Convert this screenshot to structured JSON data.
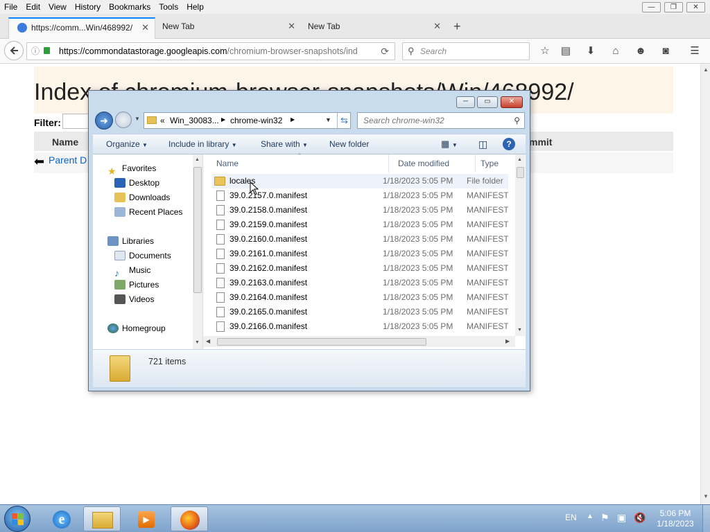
{
  "browser": {
    "menu": [
      "File",
      "Edit",
      "View",
      "History",
      "Bookmarks",
      "Tools",
      "Help"
    ],
    "window_controls": {
      "minimize": "—",
      "restore": "❐",
      "close": "✕"
    },
    "tabs": [
      {
        "label": "https://comm...Win/468992/",
        "close": "✕"
      },
      {
        "label": "New Tab",
        "close": "✕"
      },
      {
        "label": "New Tab",
        "close": "✕"
      }
    ],
    "new_tab": "+",
    "url": {
      "host": "https://commondatastorage.googleapis.com",
      "path": "/chromium-browser-snapshots/ind"
    },
    "search_placeholder": "Search",
    "reload": "⟳"
  },
  "page": {
    "heading": "Index of chromium-browser-snapshots/Win/468992/",
    "filter_label": "Filter:",
    "col_name": "Name",
    "col_commit": "mmit",
    "parent_link": "Parent D"
  },
  "dialog": {
    "breadcrumb": [
      "«",
      "Win_30083...",
      "chrome-win32"
    ],
    "search_placeholder": "Search chrome-win32",
    "toolbar": {
      "organize": "Organize",
      "include": "Include in library",
      "share": "Share with",
      "new_folder": "New folder"
    },
    "nav": {
      "favorites": "Favorites",
      "favorites_items": [
        "Desktop",
        "Downloads",
        "Recent Places"
      ],
      "libraries": "Libraries",
      "libraries_items": [
        "Documents",
        "Music",
        "Pictures",
        "Videos"
      ],
      "homegroup": "Homegroup"
    },
    "columns": {
      "name": "Name",
      "date": "Date modified",
      "type": "Type"
    },
    "files": [
      {
        "name": "locales",
        "date": "1/18/2023 5:05 PM",
        "type": "File folder",
        "folder": true
      },
      {
        "name": "39.0.2157.0.manifest",
        "date": "1/18/2023 5:05 PM",
        "type": "MANIFEST"
      },
      {
        "name": "39.0.2158.0.manifest",
        "date": "1/18/2023 5:05 PM",
        "type": "MANIFEST"
      },
      {
        "name": "39.0.2159.0.manifest",
        "date": "1/18/2023 5:05 PM",
        "type": "MANIFEST"
      },
      {
        "name": "39.0.2160.0.manifest",
        "date": "1/18/2023 5:05 PM",
        "type": "MANIFEST"
      },
      {
        "name": "39.0.2161.0.manifest",
        "date": "1/18/2023 5:05 PM",
        "type": "MANIFEST"
      },
      {
        "name": "39.0.2162.0.manifest",
        "date": "1/18/2023 5:05 PM",
        "type": "MANIFEST"
      },
      {
        "name": "39.0.2163.0.manifest",
        "date": "1/18/2023 5:05 PM",
        "type": "MANIFEST"
      },
      {
        "name": "39.0.2164.0.manifest",
        "date": "1/18/2023 5:05 PM",
        "type": "MANIFEST"
      },
      {
        "name": "39.0.2165.0.manifest",
        "date": "1/18/2023 5:05 PM",
        "type": "MANIFEST"
      },
      {
        "name": "39.0.2166.0.manifest",
        "date": "1/18/2023 5:05 PM",
        "type": "MANIFEST"
      }
    ],
    "item_count": "721 items"
  },
  "taskbar": {
    "lang": "EN",
    "time": "5:06 PM",
    "date": "1/18/2023"
  },
  "colors": {
    "link": "#0066cc",
    "page_header_bg": "#fdf5e8",
    "dialog_frame": "#c9dced",
    "taskbar": "#8eaed3"
  }
}
